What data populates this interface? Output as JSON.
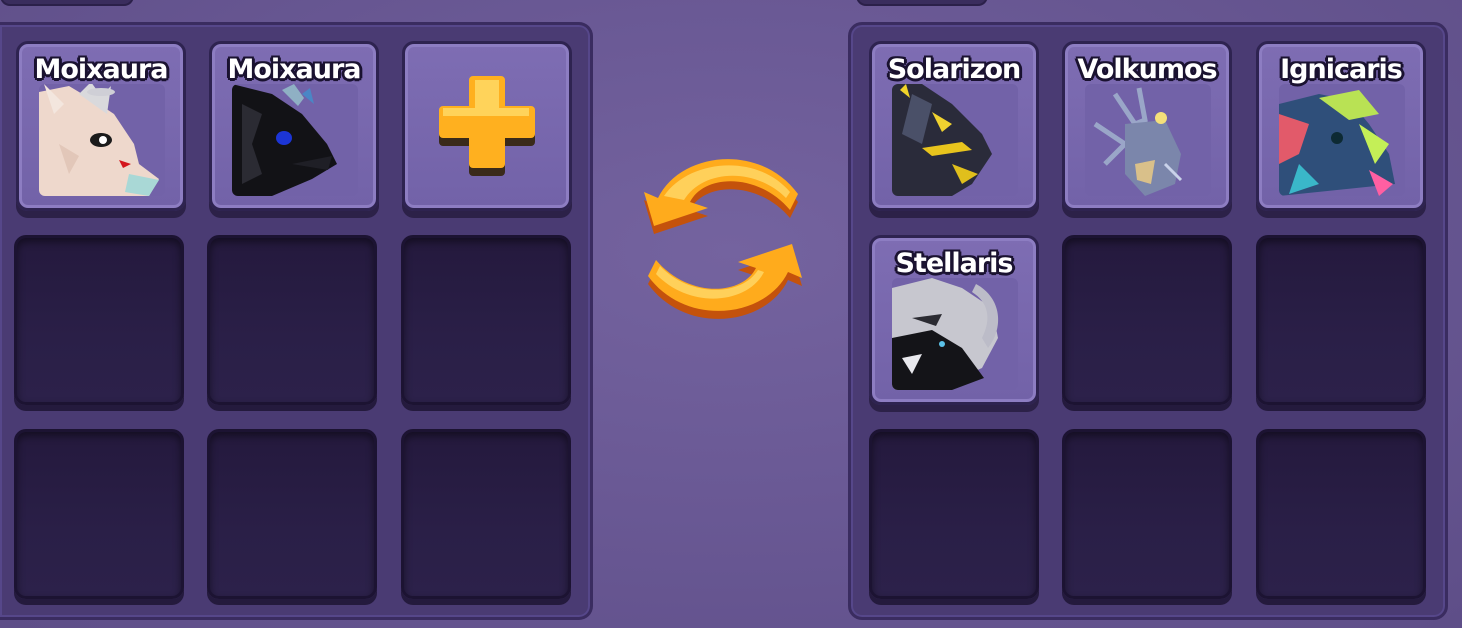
{
  "colors": {
    "background": "#6a5995",
    "panel": "#4a3b73",
    "slot_filled": "#7a69ae",
    "slot_empty": "#2a1f47",
    "accent_orange": "#ffb020"
  },
  "left_inventory": {
    "slots": [
      {
        "type": "creature",
        "name": "Moixaura",
        "icon": "moixaura-white-portrait"
      },
      {
        "type": "creature",
        "name": "Moixaura",
        "icon": "moixaura-black-portrait"
      },
      {
        "type": "add",
        "icon": "plus-icon"
      },
      {
        "type": "empty"
      },
      {
        "type": "empty"
      },
      {
        "type": "empty"
      },
      {
        "type": "empty"
      },
      {
        "type": "empty"
      },
      {
        "type": "empty"
      }
    ]
  },
  "swap_button": {
    "icon": "swap-arrows-icon"
  },
  "right_inventory": {
    "slots": [
      {
        "type": "creature",
        "name": "Solarizon",
        "icon": "solarizon-portrait"
      },
      {
        "type": "creature",
        "name": "Volkumos",
        "icon": "volkumos-portrait"
      },
      {
        "type": "creature",
        "name": "Ignicaris",
        "icon": "ignicaris-portrait"
      },
      {
        "type": "creature",
        "name": "Stellaris",
        "icon": "stellaris-portrait"
      },
      {
        "type": "empty"
      },
      {
        "type": "empty"
      },
      {
        "type": "empty"
      },
      {
        "type": "empty"
      },
      {
        "type": "empty"
      }
    ]
  }
}
